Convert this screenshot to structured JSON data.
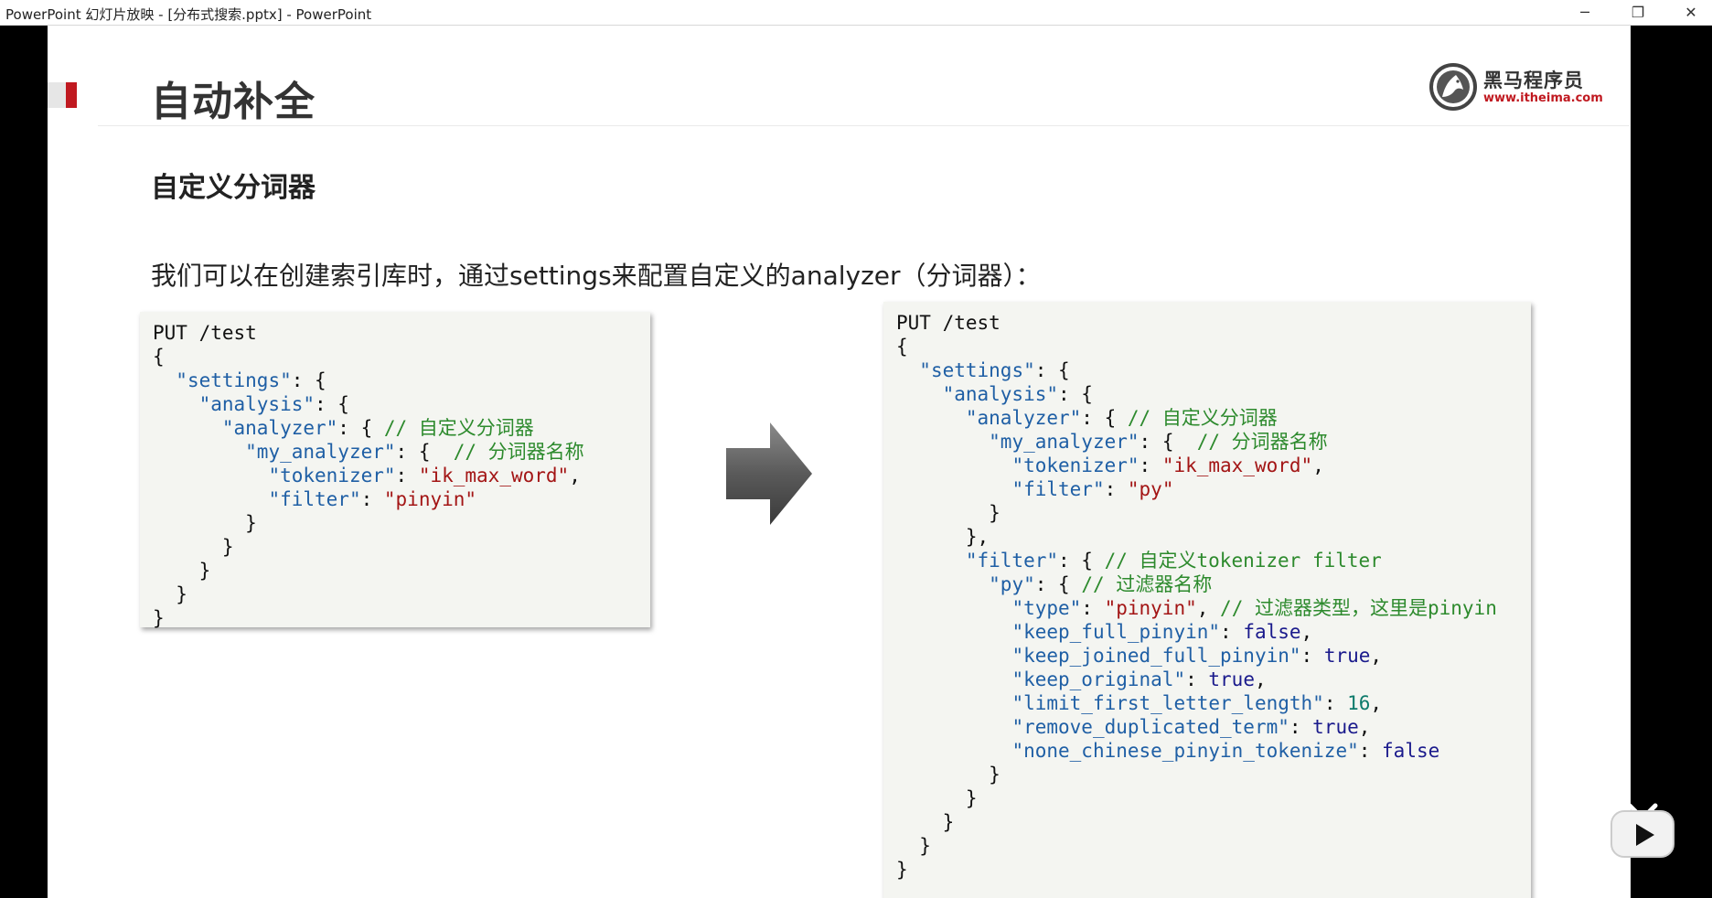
{
  "window": {
    "title": "PowerPoint 幻灯片放映 - [分布式搜索.pptx] - PowerPoint",
    "minimize_glyph": "─",
    "restore_glyph": "❐",
    "close_glyph": "✕"
  },
  "slide": {
    "title": "自动补全",
    "subtitle": "自定义分词器",
    "description": "我们可以在创建索引库时，通过settings来配置自定义的analyzer（分词器）：",
    "logo": {
      "name": "黑马程序员",
      "url": "www.itheima.com",
      "icon": "horse-logo-icon"
    },
    "accent_color": "#c01920"
  },
  "code_left": {
    "lines": [
      [
        {
          "t": "PUT /test",
          "c": ""
        }
      ],
      [
        {
          "t": "{",
          "c": ""
        }
      ],
      [
        {
          "t": "  ",
          "c": ""
        },
        {
          "t": "\"settings\"",
          "c": "k"
        },
        {
          "t": ": {",
          "c": ""
        }
      ],
      [
        {
          "t": "    ",
          "c": ""
        },
        {
          "t": "\"analysis\"",
          "c": "k"
        },
        {
          "t": ": {",
          "c": ""
        }
      ],
      [
        {
          "t": "      ",
          "c": ""
        },
        {
          "t": "\"analyzer\"",
          "c": "k"
        },
        {
          "t": ": { ",
          "c": ""
        },
        {
          "t": "// 自定义分词器",
          "c": "c"
        }
      ],
      [
        {
          "t": "        ",
          "c": ""
        },
        {
          "t": "\"my_analyzer\"",
          "c": "k"
        },
        {
          "t": ": {  ",
          "c": ""
        },
        {
          "t": "// 分词器名称",
          "c": "c"
        }
      ],
      [
        {
          "t": "          ",
          "c": ""
        },
        {
          "t": "\"tokenizer\"",
          "c": "k"
        },
        {
          "t": ": ",
          "c": ""
        },
        {
          "t": "\"ik_max_word\"",
          "c": "s"
        },
        {
          "t": ",",
          "c": ""
        }
      ],
      [
        {
          "t": "          ",
          "c": ""
        },
        {
          "t": "\"filter\"",
          "c": "k"
        },
        {
          "t": ": ",
          "c": ""
        },
        {
          "t": "\"pinyin\"",
          "c": "s"
        }
      ],
      [
        {
          "t": "        }",
          "c": ""
        }
      ],
      [
        {
          "t": "      }",
          "c": ""
        }
      ],
      [
        {
          "t": "    }",
          "c": ""
        }
      ],
      [
        {
          "t": "  }",
          "c": ""
        }
      ],
      [
        {
          "t": "}",
          "c": ""
        }
      ]
    ]
  },
  "code_right": {
    "lines": [
      [
        {
          "t": "PUT /test",
          "c": ""
        }
      ],
      [
        {
          "t": "{",
          "c": ""
        }
      ],
      [
        {
          "t": "  ",
          "c": ""
        },
        {
          "t": "\"settings\"",
          "c": "k"
        },
        {
          "t": ": {",
          "c": ""
        }
      ],
      [
        {
          "t": "    ",
          "c": ""
        },
        {
          "t": "\"analysis\"",
          "c": "k"
        },
        {
          "t": ": {",
          "c": ""
        }
      ],
      [
        {
          "t": "      ",
          "c": ""
        },
        {
          "t": "\"analyzer\"",
          "c": "k"
        },
        {
          "t": ": { ",
          "c": ""
        },
        {
          "t": "// 自定义分词器",
          "c": "c"
        }
      ],
      [
        {
          "t": "        ",
          "c": ""
        },
        {
          "t": "\"my_analyzer\"",
          "c": "k"
        },
        {
          "t": ": {  ",
          "c": ""
        },
        {
          "t": "// 分词器名称",
          "c": "c"
        }
      ],
      [
        {
          "t": "          ",
          "c": ""
        },
        {
          "t": "\"tokenizer\"",
          "c": "k"
        },
        {
          "t": ": ",
          "c": ""
        },
        {
          "t": "\"ik_max_word\"",
          "c": "s"
        },
        {
          "t": ",",
          "c": ""
        }
      ],
      [
        {
          "t": "          ",
          "c": ""
        },
        {
          "t": "\"filter\"",
          "c": "k"
        },
        {
          "t": ": ",
          "c": ""
        },
        {
          "t": "\"py\"",
          "c": "s"
        }
      ],
      [
        {
          "t": "        }",
          "c": ""
        }
      ],
      [
        {
          "t": "      },",
          "c": ""
        }
      ],
      [
        {
          "t": "      ",
          "c": ""
        },
        {
          "t": "\"filter\"",
          "c": "k"
        },
        {
          "t": ": { ",
          "c": ""
        },
        {
          "t": "// 自定义tokenizer filter",
          "c": "c"
        }
      ],
      [
        {
          "t": "        ",
          "c": ""
        },
        {
          "t": "\"py\"",
          "c": "k"
        },
        {
          "t": ": { ",
          "c": ""
        },
        {
          "t": "// 过滤器名称",
          "c": "c"
        }
      ],
      [
        {
          "t": "          ",
          "c": ""
        },
        {
          "t": "\"type\"",
          "c": "k"
        },
        {
          "t": ": ",
          "c": ""
        },
        {
          "t": "\"pinyin\"",
          "c": "s"
        },
        {
          "t": ", ",
          "c": ""
        },
        {
          "t": "// 过滤器类型，这里是pinyin",
          "c": "c"
        }
      ],
      [
        {
          "t": "          ",
          "c": ""
        },
        {
          "t": "\"keep_full_pinyin\"",
          "c": "k"
        },
        {
          "t": ": ",
          "c": ""
        },
        {
          "t": "false",
          "c": "b"
        },
        {
          "t": ",",
          "c": ""
        }
      ],
      [
        {
          "t": "          ",
          "c": ""
        },
        {
          "t": "\"keep_joined_full_pinyin\"",
          "c": "k"
        },
        {
          "t": ": ",
          "c": ""
        },
        {
          "t": "true",
          "c": "b"
        },
        {
          "t": ",",
          "c": ""
        }
      ],
      [
        {
          "t": "          ",
          "c": ""
        },
        {
          "t": "\"keep_original\"",
          "c": "k"
        },
        {
          "t": ": ",
          "c": ""
        },
        {
          "t": "true",
          "c": "b"
        },
        {
          "t": ",",
          "c": ""
        }
      ],
      [
        {
          "t": "          ",
          "c": ""
        },
        {
          "t": "\"limit_first_letter_length\"",
          "c": "k"
        },
        {
          "t": ": ",
          "c": ""
        },
        {
          "t": "16",
          "c": "n"
        },
        {
          "t": ",",
          "c": ""
        }
      ],
      [
        {
          "t": "          ",
          "c": ""
        },
        {
          "t": "\"remove_duplicated_term\"",
          "c": "k"
        },
        {
          "t": ": ",
          "c": ""
        },
        {
          "t": "true",
          "c": "b"
        },
        {
          "t": ",",
          "c": ""
        }
      ],
      [
        {
          "t": "          ",
          "c": ""
        },
        {
          "t": "\"none_chinese_pinyin_tokenize\"",
          "c": "k"
        },
        {
          "t": ": ",
          "c": ""
        },
        {
          "t": "false",
          "c": "b"
        }
      ],
      [
        {
          "t": "        }",
          "c": ""
        }
      ],
      [
        {
          "t": "      }",
          "c": ""
        }
      ],
      [
        {
          "t": "    }",
          "c": ""
        }
      ],
      [
        {
          "t": "  }",
          "c": ""
        }
      ],
      [
        {
          "t": "}",
          "c": ""
        }
      ]
    ]
  },
  "icons": {
    "arrow": "right-arrow-icon",
    "play": "bilibili-play-icon"
  }
}
